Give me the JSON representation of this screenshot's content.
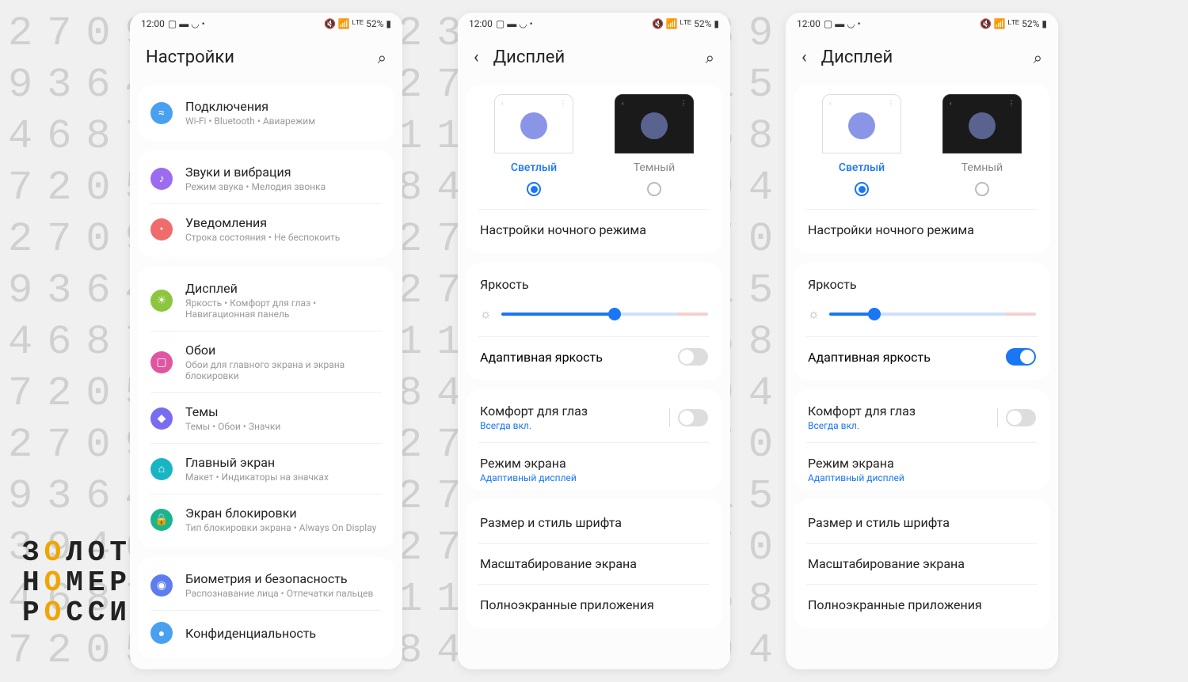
{
  "bg_numbers": "270936481523648725394619720\n936401581527093648152351300\n468725394611936401581647661\n720583270984687253946712397\n270936481527205832709648726\n936401581527093648152351300\n468725394611936401581647661\n720583270984687253946712397\n270936481527205832709648726\n936401581527093648152351300\n394618468727205832709648726\n468725394611936401581647661\n720583270984687253946712397",
  "logo": {
    "l1": "З",
    "l1b": "О",
    "l1c": "ЛОТЫЕ",
    "l2": "Н",
    "l2b": "О",
    "l2c": "МЕРА",
    "l3": "Р",
    "l3b": "О",
    "l3c": "ССИИ"
  },
  "status": {
    "time": "12:00",
    "battery": "52%"
  },
  "screen1": {
    "title": "Настройки",
    "items": [
      {
        "icon_bg": "#4aa0f0",
        "glyph": "≈",
        "title": "Подключения",
        "sub": "Wi-Fi • Bluetooth • Авиарежим"
      },
      {
        "icon_bg": "#9c6cf0",
        "glyph": "♪",
        "title": "Звуки и вибрация",
        "sub": "Режим звука • Мелодия звонка"
      },
      {
        "icon_bg": "#f06c6c",
        "glyph": "•",
        "title": "Уведомления",
        "sub": "Строка состояния • Не беспокоить"
      },
      {
        "icon_bg": "#8cc63f",
        "glyph": "☀",
        "title": "Дисплей",
        "sub": "Яркость • Комфорт для глаз • Навигационная панель"
      },
      {
        "icon_bg": "#e055a0",
        "glyph": "▢",
        "title": "Обои",
        "sub": "Обои для главного экрана и экрана блокировки"
      },
      {
        "icon_bg": "#7a6cf0",
        "glyph": "◆",
        "title": "Темы",
        "sub": "Темы • Обои • Значки"
      },
      {
        "icon_bg": "#1ab5c4",
        "glyph": "⌂",
        "title": "Главный экран",
        "sub": "Макет • Индикаторы на значках"
      },
      {
        "icon_bg": "#1ab58c",
        "glyph": "🔒",
        "title": "Экран блокировки",
        "sub": "Тип блокировки экрана • Always On Display"
      },
      {
        "icon_bg": "#5c7cf0",
        "glyph": "◉",
        "title": "Биометрия и безопасность",
        "sub": "Распознавание лица • Отпечатки пальцев"
      },
      {
        "icon_bg": "#4aa0f0",
        "glyph": "●",
        "title": "Конфиденциальность",
        "sub": ""
      }
    ]
  },
  "screen23": {
    "title": "Дисплей",
    "theme_light": "Светлый",
    "theme_dark": "Темный",
    "night_mode": "Настройки ночного режима",
    "brightness": "Яркость",
    "adaptive": "Адаптивная яркость",
    "slider2": 55,
    "slider3": 22,
    "adaptive2": false,
    "adaptive3": true,
    "comfort": "Комфорт для глаз",
    "comfort_sub": "Всегда вкл.",
    "screen_mode": "Режим экрана",
    "screen_mode_sub": "Адаптивный дисплей",
    "font": "Размер и стиль шрифта",
    "zoom": "Масштабирование экрана",
    "fullscreen": "Полноэкранные приложения"
  }
}
